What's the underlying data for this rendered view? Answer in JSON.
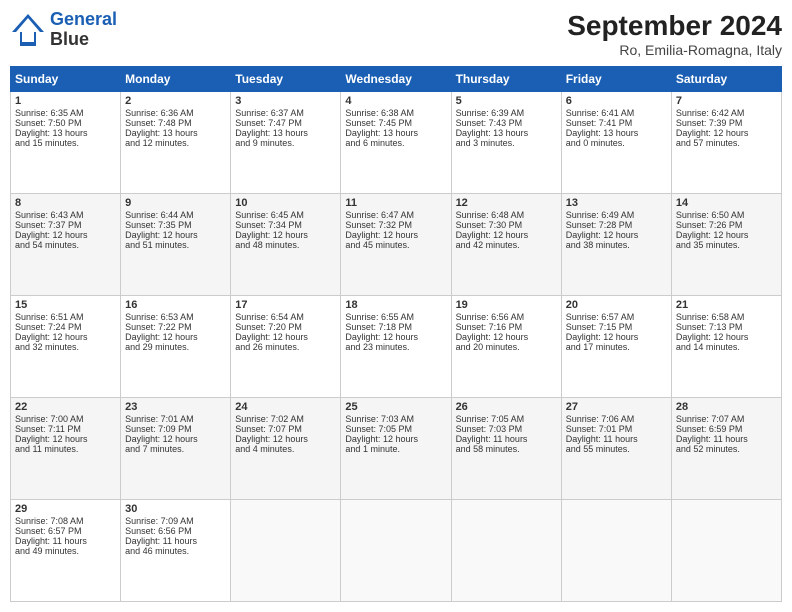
{
  "header": {
    "logo_line1": "General",
    "logo_line2": "Blue",
    "month": "September 2024",
    "location": "Ro, Emilia-Romagna, Italy"
  },
  "days_of_week": [
    "Sunday",
    "Monday",
    "Tuesday",
    "Wednesday",
    "Thursday",
    "Friday",
    "Saturday"
  ],
  "weeks": [
    [
      {
        "day": "1",
        "lines": [
          "Sunrise: 6:35 AM",
          "Sunset: 7:50 PM",
          "Daylight: 13 hours",
          "and 15 minutes."
        ]
      },
      {
        "day": "2",
        "lines": [
          "Sunrise: 6:36 AM",
          "Sunset: 7:48 PM",
          "Daylight: 13 hours",
          "and 12 minutes."
        ]
      },
      {
        "day": "3",
        "lines": [
          "Sunrise: 6:37 AM",
          "Sunset: 7:47 PM",
          "Daylight: 13 hours",
          "and 9 minutes."
        ]
      },
      {
        "day": "4",
        "lines": [
          "Sunrise: 6:38 AM",
          "Sunset: 7:45 PM",
          "Daylight: 13 hours",
          "and 6 minutes."
        ]
      },
      {
        "day": "5",
        "lines": [
          "Sunrise: 6:39 AM",
          "Sunset: 7:43 PM",
          "Daylight: 13 hours",
          "and 3 minutes."
        ]
      },
      {
        "day": "6",
        "lines": [
          "Sunrise: 6:41 AM",
          "Sunset: 7:41 PM",
          "Daylight: 13 hours",
          "and 0 minutes."
        ]
      },
      {
        "day": "7",
        "lines": [
          "Sunrise: 6:42 AM",
          "Sunset: 7:39 PM",
          "Daylight: 12 hours",
          "and 57 minutes."
        ]
      }
    ],
    [
      {
        "day": "8",
        "lines": [
          "Sunrise: 6:43 AM",
          "Sunset: 7:37 PM",
          "Daylight: 12 hours",
          "and 54 minutes."
        ]
      },
      {
        "day": "9",
        "lines": [
          "Sunrise: 6:44 AM",
          "Sunset: 7:35 PM",
          "Daylight: 12 hours",
          "and 51 minutes."
        ]
      },
      {
        "day": "10",
        "lines": [
          "Sunrise: 6:45 AM",
          "Sunset: 7:34 PM",
          "Daylight: 12 hours",
          "and 48 minutes."
        ]
      },
      {
        "day": "11",
        "lines": [
          "Sunrise: 6:47 AM",
          "Sunset: 7:32 PM",
          "Daylight: 12 hours",
          "and 45 minutes."
        ]
      },
      {
        "day": "12",
        "lines": [
          "Sunrise: 6:48 AM",
          "Sunset: 7:30 PM",
          "Daylight: 12 hours",
          "and 42 minutes."
        ]
      },
      {
        "day": "13",
        "lines": [
          "Sunrise: 6:49 AM",
          "Sunset: 7:28 PM",
          "Daylight: 12 hours",
          "and 38 minutes."
        ]
      },
      {
        "day": "14",
        "lines": [
          "Sunrise: 6:50 AM",
          "Sunset: 7:26 PM",
          "Daylight: 12 hours",
          "and 35 minutes."
        ]
      }
    ],
    [
      {
        "day": "15",
        "lines": [
          "Sunrise: 6:51 AM",
          "Sunset: 7:24 PM",
          "Daylight: 12 hours",
          "and 32 minutes."
        ]
      },
      {
        "day": "16",
        "lines": [
          "Sunrise: 6:53 AM",
          "Sunset: 7:22 PM",
          "Daylight: 12 hours",
          "and 29 minutes."
        ]
      },
      {
        "day": "17",
        "lines": [
          "Sunrise: 6:54 AM",
          "Sunset: 7:20 PM",
          "Daylight: 12 hours",
          "and 26 minutes."
        ]
      },
      {
        "day": "18",
        "lines": [
          "Sunrise: 6:55 AM",
          "Sunset: 7:18 PM",
          "Daylight: 12 hours",
          "and 23 minutes."
        ]
      },
      {
        "day": "19",
        "lines": [
          "Sunrise: 6:56 AM",
          "Sunset: 7:16 PM",
          "Daylight: 12 hours",
          "and 20 minutes."
        ]
      },
      {
        "day": "20",
        "lines": [
          "Sunrise: 6:57 AM",
          "Sunset: 7:15 PM",
          "Daylight: 12 hours",
          "and 17 minutes."
        ]
      },
      {
        "day": "21",
        "lines": [
          "Sunrise: 6:58 AM",
          "Sunset: 7:13 PM",
          "Daylight: 12 hours",
          "and 14 minutes."
        ]
      }
    ],
    [
      {
        "day": "22",
        "lines": [
          "Sunrise: 7:00 AM",
          "Sunset: 7:11 PM",
          "Daylight: 12 hours",
          "and 11 minutes."
        ]
      },
      {
        "day": "23",
        "lines": [
          "Sunrise: 7:01 AM",
          "Sunset: 7:09 PM",
          "Daylight: 12 hours",
          "and 7 minutes."
        ]
      },
      {
        "day": "24",
        "lines": [
          "Sunrise: 7:02 AM",
          "Sunset: 7:07 PM",
          "Daylight: 12 hours",
          "and 4 minutes."
        ]
      },
      {
        "day": "25",
        "lines": [
          "Sunrise: 7:03 AM",
          "Sunset: 7:05 PM",
          "Daylight: 12 hours",
          "and 1 minute."
        ]
      },
      {
        "day": "26",
        "lines": [
          "Sunrise: 7:05 AM",
          "Sunset: 7:03 PM",
          "Daylight: 11 hours",
          "and 58 minutes."
        ]
      },
      {
        "day": "27",
        "lines": [
          "Sunrise: 7:06 AM",
          "Sunset: 7:01 PM",
          "Daylight: 11 hours",
          "and 55 minutes."
        ]
      },
      {
        "day": "28",
        "lines": [
          "Sunrise: 7:07 AM",
          "Sunset: 6:59 PM",
          "Daylight: 11 hours",
          "and 52 minutes."
        ]
      }
    ],
    [
      {
        "day": "29",
        "lines": [
          "Sunrise: 7:08 AM",
          "Sunset: 6:57 PM",
          "Daylight: 11 hours",
          "and 49 minutes."
        ]
      },
      {
        "day": "30",
        "lines": [
          "Sunrise: 7:09 AM",
          "Sunset: 6:56 PM",
          "Daylight: 11 hours",
          "and 46 minutes."
        ]
      },
      {
        "day": "",
        "lines": []
      },
      {
        "day": "",
        "lines": []
      },
      {
        "day": "",
        "lines": []
      },
      {
        "day": "",
        "lines": []
      },
      {
        "day": "",
        "lines": []
      }
    ]
  ]
}
